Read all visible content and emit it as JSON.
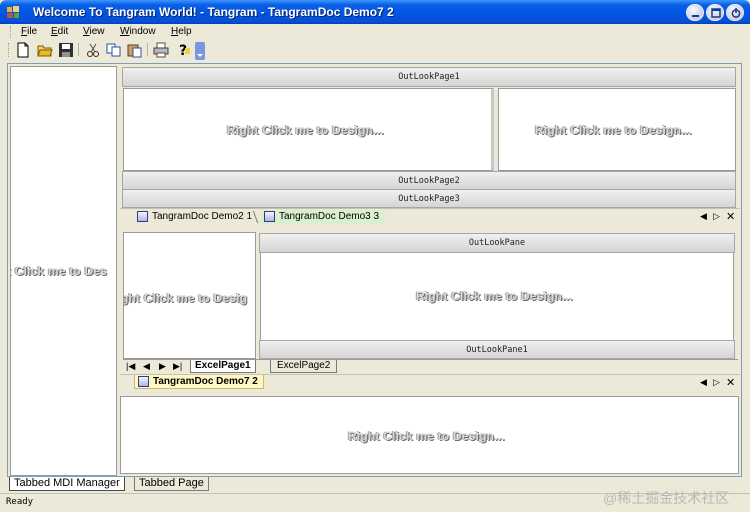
{
  "window": {
    "title": "Welcome To Tangram World! - Tangram - TangramDoc Demo7 2"
  },
  "menu": {
    "items": [
      {
        "accel": "F",
        "rest": "ile"
      },
      {
        "accel": "E",
        "rest": "dit"
      },
      {
        "accel": "V",
        "rest": "iew"
      },
      {
        "accel": "W",
        "rest": "indow"
      },
      {
        "accel": "H",
        "rest": "elp"
      }
    ]
  },
  "toolbar": {
    "icons": [
      "new-file-icon",
      "open-folder-icon",
      "save-disk-icon",
      "cut-icon",
      "copy-icon",
      "paste-icon",
      "print-icon",
      "help-question-icon"
    ]
  },
  "design_prompt": "Right Click me to Design...",
  "left_panel": {
    "text": "t Click me to Des"
  },
  "outlook_top": {
    "page1": "OutLookPage1",
    "page2": "OutLookPage2",
    "page3": "OutLookPage3"
  },
  "doc_tabs_top": {
    "tabs": [
      "TangramDoc Demo2 1",
      "TangramDoc Demo3 3"
    ]
  },
  "middle": {
    "left_text": "ght Click me to Desig",
    "outlook_pane": "OutLookPane",
    "outlook_pane1": "OutLookPane1",
    "excel_tabs": [
      "ExcelPage1",
      "ExcelPage2"
    ]
  },
  "doc_tabs_bottom": {
    "tabs": [
      "TangramDoc Demo7 2"
    ]
  },
  "bottom_tabs": [
    "Tabbed MDI Manager",
    "Tabbed Page"
  ],
  "status": {
    "text": "Ready"
  },
  "watermark": "@稀土掘金技术社区",
  "colors": {
    "title_bar": "#0054e3",
    "window_bg": "#ece9d8",
    "active_tab": "#fff7c2"
  }
}
